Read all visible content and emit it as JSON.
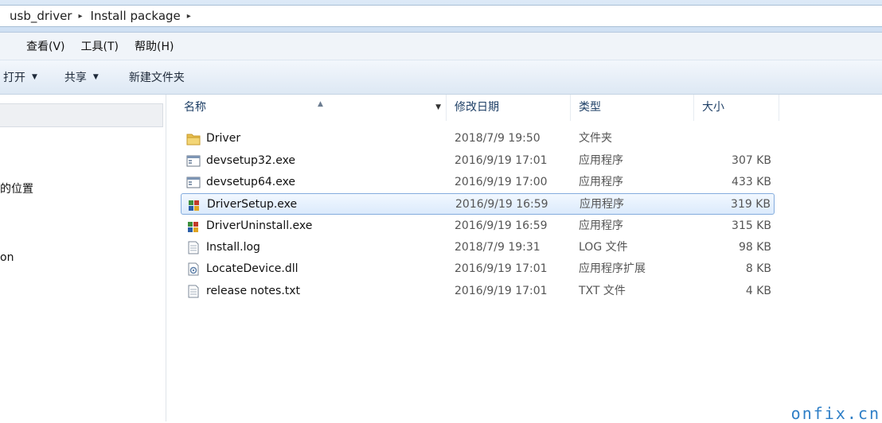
{
  "address": {
    "crumbs": [
      "usb_driver",
      "Install package"
    ],
    "separator": "▸"
  },
  "menu": [
    "查看(V)",
    "工具(T)",
    "帮助(H)"
  ],
  "toolbar": {
    "open_label": "打开",
    "share_label": "共享",
    "new_folder_label": "新建文件夹"
  },
  "nav": {
    "partial_items": [
      "的位置",
      "on"
    ]
  },
  "columns": {
    "name": "名称",
    "date": "修改日期",
    "type": "类型",
    "size": "大小"
  },
  "files": [
    {
      "name": "Driver",
      "date": "2018/7/9 19:50",
      "type": "文件夹",
      "size": "",
      "icon": "folder-icon"
    },
    {
      "name": "devsetup32.exe",
      "date": "2016/9/19 17:01",
      "type": "应用程序",
      "size": "307 KB",
      "icon": "exe-window-icon"
    },
    {
      "name": "devsetup64.exe",
      "date": "2016/9/19 17:00",
      "type": "应用程序",
      "size": "433 KB",
      "icon": "exe-window-icon"
    },
    {
      "name": "DriverSetup.exe",
      "date": "2016/9/19 16:59",
      "type": "应用程序",
      "size": "319 KB",
      "icon": "installer-icon",
      "selected": true
    },
    {
      "name": "DriverUninstall.exe",
      "date": "2016/9/19 16:59",
      "type": "应用程序",
      "size": "315 KB",
      "icon": "installer-icon"
    },
    {
      "name": "Install.log",
      "date": "2018/7/9 19:31",
      "type": "LOG 文件",
      "size": "98 KB",
      "icon": "text-file-icon"
    },
    {
      "name": "LocateDevice.dll",
      "date": "2016/9/19 17:01",
      "type": "应用程序扩展",
      "size": "8 KB",
      "icon": "dll-file-icon"
    },
    {
      "name": "release notes.txt",
      "date": "2016/9/19 17:01",
      "type": "TXT 文件",
      "size": "4 KB",
      "icon": "text-file-icon"
    }
  ],
  "watermark": "onfix.cn"
}
